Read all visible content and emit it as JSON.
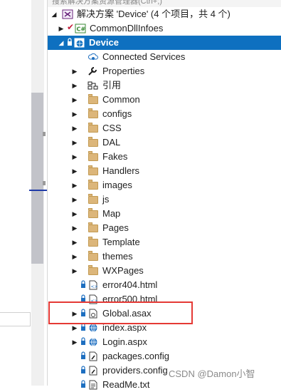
{
  "header": {
    "clipped_text": "搜索解决方案资源管理器(Ctrl+;)"
  },
  "solution": {
    "label": "解决方案 'Device' (4 个项目，共 4 个)"
  },
  "projects": {
    "common_dll": "CommonDllInfoes",
    "device": "Device"
  },
  "items": [
    {
      "label": "Connected Services",
      "icon": "connected-services-icon"
    },
    {
      "label": "Properties",
      "icon": "wrench-icon"
    },
    {
      "label": "引用",
      "icon": "references-icon"
    },
    {
      "label": "Common",
      "icon": "folder-icon"
    },
    {
      "label": "configs",
      "icon": "folder-icon"
    },
    {
      "label": "CSS",
      "icon": "folder-icon"
    },
    {
      "label": "DAL",
      "icon": "folder-icon"
    },
    {
      "label": "Fakes",
      "icon": "folder-icon"
    },
    {
      "label": "Handlers",
      "icon": "folder-icon"
    },
    {
      "label": "images",
      "icon": "folder-icon"
    },
    {
      "label": "js",
      "icon": "folder-icon"
    },
    {
      "label": "Map",
      "icon": "folder-icon"
    },
    {
      "label": "Pages",
      "icon": "folder-icon"
    },
    {
      "label": "Template",
      "icon": "folder-icon"
    },
    {
      "label": "themes",
      "icon": "folder-icon"
    },
    {
      "label": "WXPages",
      "icon": "folder-icon"
    },
    {
      "label": "error404.html",
      "icon": "html-file-icon"
    },
    {
      "label": "error500.html",
      "icon": "html-file-icon"
    },
    {
      "label": "Global.asax",
      "icon": "asax-file-icon"
    },
    {
      "label": "index.aspx",
      "icon": "aspx-file-icon"
    },
    {
      "label": "Login.aspx",
      "icon": "aspx-file-icon"
    },
    {
      "label": "packages.config",
      "icon": "config-file-icon"
    },
    {
      "label": "providers.config",
      "icon": "config-file-icon"
    },
    {
      "label": "ReadMe.txt",
      "icon": "text-file-icon"
    }
  ],
  "watermark": "CSDN @Damon小智",
  "colors": {
    "selection": "#0e70c0",
    "highlight_box": "#e53935",
    "folder": "#dcb67a"
  }
}
